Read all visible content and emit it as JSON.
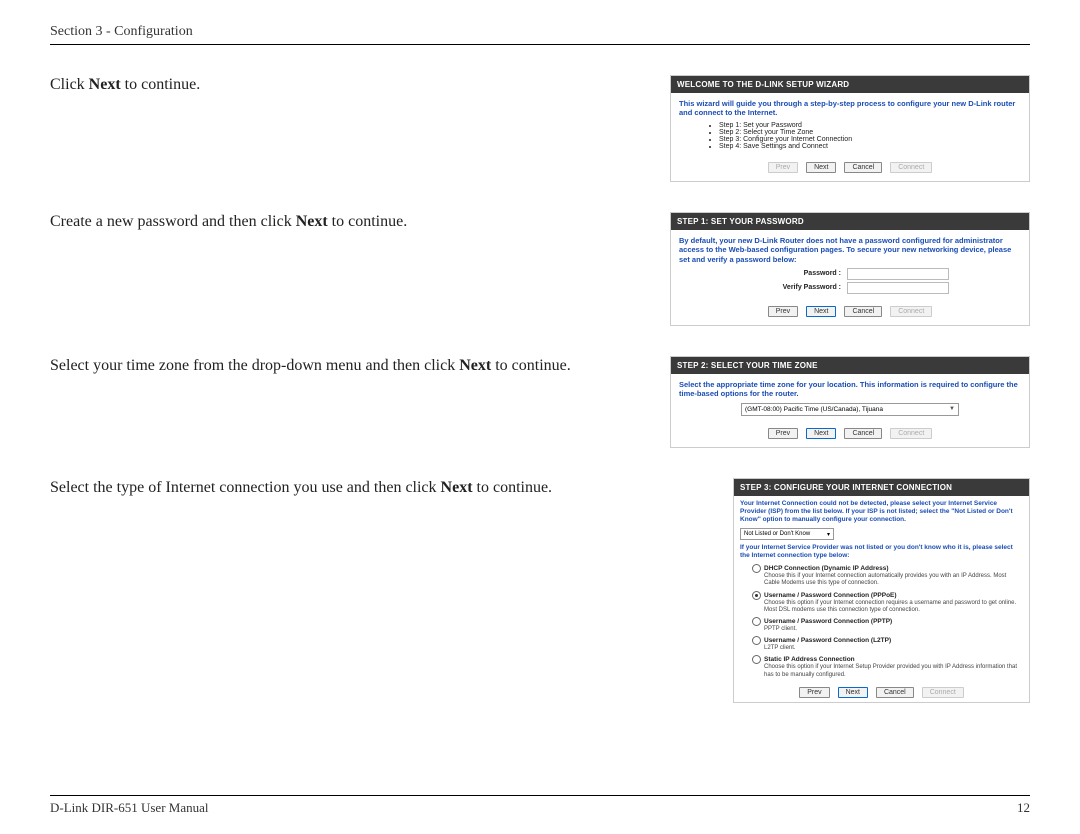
{
  "header": {
    "section": "Section 3 - Configuration"
  },
  "footer": {
    "manual": "D-Link DIR-651 User Manual",
    "page": "12"
  },
  "instructions": {
    "i1a": "Click ",
    "i1b": "Next",
    "i1c": " to continue.",
    "i2a": "Create a new password and then click ",
    "i2b": "Next",
    "i2c": " to continue.",
    "i3a": "Select your time zone from the drop-down menu and then click ",
    "i3b": "Next",
    "i3c": " to continue.",
    "i4a": "Select the type of Internet connection you use and then click ",
    "i4b": "Next",
    "i4c": " to continue."
  },
  "panel1": {
    "title": "WELCOME TO THE D-LINK SETUP WIZARD",
    "intro": "This wizard will guide you through a step-by-step process to configure your new D-Link router and connect to the Internet.",
    "steps": [
      "Step 1: Set your Password",
      "Step 2: Select your Time Zone",
      "Step 3: Configure your Internet Connection",
      "Step 4: Save Settings and Connect"
    ],
    "buttons": {
      "prev": "Prev",
      "next": "Next",
      "cancel": "Cancel",
      "connect": "Connect"
    }
  },
  "panel2": {
    "title": "STEP 1: SET YOUR PASSWORD",
    "intro": "By default, your new D-Link Router does not have a password configured for administrator access to the Web-based configuration pages. To secure your new networking device, please set and verify a password below:",
    "labels": {
      "password": "Password :",
      "verify": "Verify Password :"
    },
    "buttons": {
      "prev": "Prev",
      "next": "Next",
      "cancel": "Cancel",
      "connect": "Connect"
    }
  },
  "panel3": {
    "title": "STEP 2: SELECT YOUR TIME ZONE",
    "intro": "Select the appropriate time zone for your location. This information is required to configure the time-based options for the router.",
    "tz": "(GMT-08:00) Pacific Time (US/Canada), Tijuana",
    "buttons": {
      "prev": "Prev",
      "next": "Next",
      "cancel": "Cancel",
      "connect": "Connect"
    }
  },
  "panel4": {
    "title": "STEP 3: CONFIGURE YOUR INTERNET CONNECTION",
    "intro1": "Your Internet Connection could not be detected, please select your Internet Service Provider (ISP) from the list below. If your ISP is not listed; select the \"Not Listed or Don't Know\" option to manually configure your connection.",
    "isp_selected": "Not Listed or Don't Know",
    "intro2": "If your Internet Service Provider was not listed or you don't know who it is, please select the Internet connection type below:",
    "options": [
      {
        "name": "DHCP Connection (Dynamic IP Address)",
        "desc": "Choose this if your Internet connection automatically provides you with an IP Address. Most Cable Modems use this type of connection.",
        "checked": false
      },
      {
        "name": "Username / Password Connection (PPPoE)",
        "desc": "Choose this option if your Internet connection requires a username and password to get online. Most DSL modems use this connection type of connection.",
        "checked": true
      },
      {
        "name": "Username / Password Connection (PPTP)",
        "desc": "PPTP client.",
        "checked": false
      },
      {
        "name": "Username / Password Connection (L2TP)",
        "desc": "L2TP client.",
        "checked": false
      },
      {
        "name": "Static IP Address Connection",
        "desc": "Choose this option if your Internet Setup Provider provided you with IP Address information that has to be manually configured.",
        "checked": false
      }
    ],
    "buttons": {
      "prev": "Prev",
      "next": "Next",
      "cancel": "Cancel",
      "connect": "Connect"
    }
  }
}
